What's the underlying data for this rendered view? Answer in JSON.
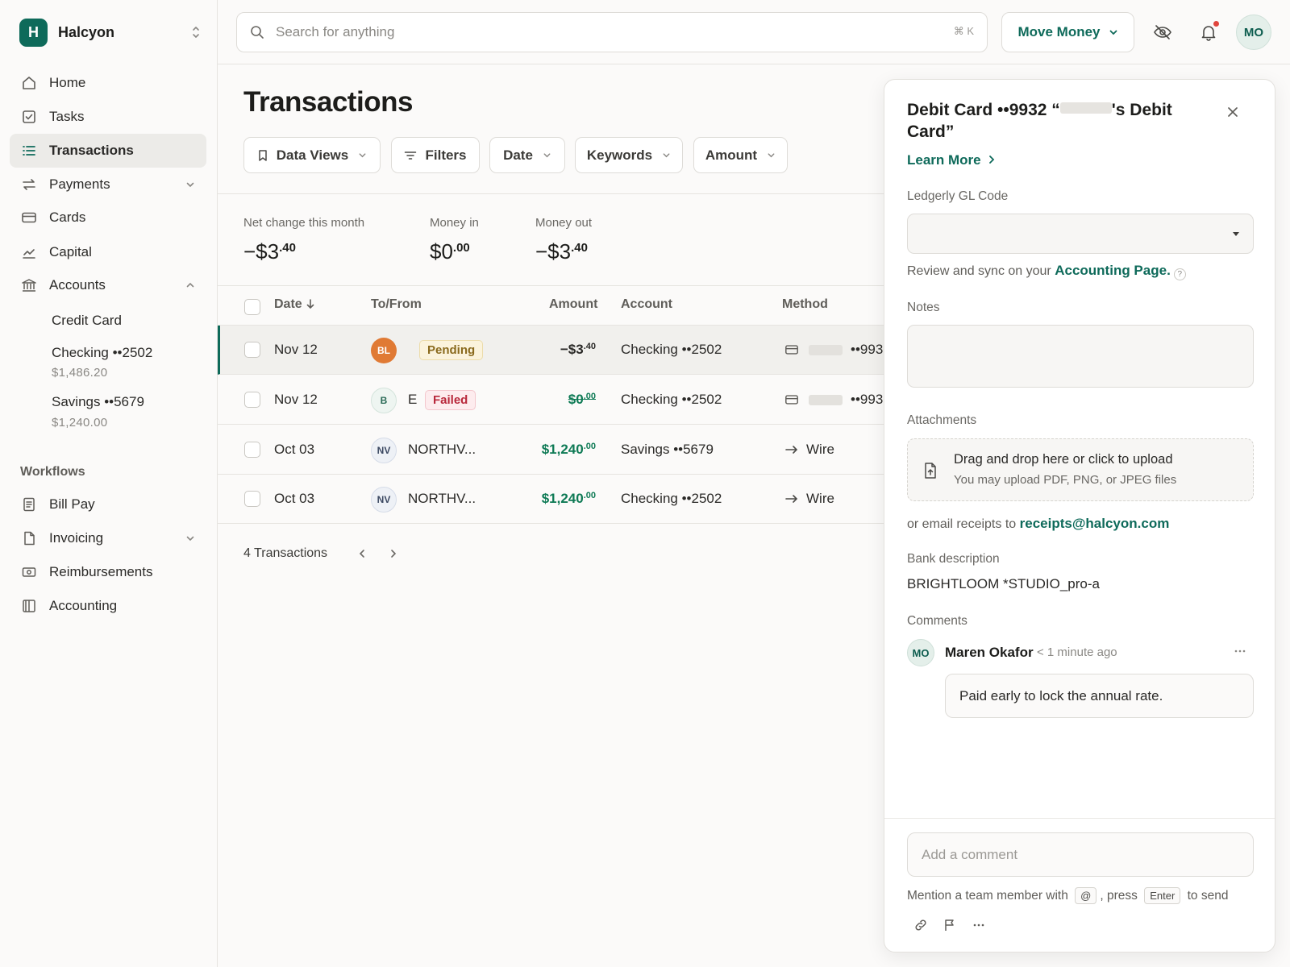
{
  "brand": {
    "initial": "H",
    "name": "Halcyon"
  },
  "nav": {
    "items": [
      {
        "label": "Home",
        "icon": "home-icon"
      },
      {
        "label": "Tasks",
        "icon": "checkbox-icon"
      },
      {
        "label": "Transactions",
        "icon": "list-icon",
        "active": true
      },
      {
        "label": "Payments",
        "icon": "arrows-icon"
      },
      {
        "label": "Cards",
        "icon": "card-icon"
      },
      {
        "label": "Capital",
        "icon": "chart-icon"
      },
      {
        "label": "Accounts",
        "icon": "bank-icon"
      }
    ],
    "accounts": [
      {
        "label": "Credit Card"
      },
      {
        "label": "Checking ••2502",
        "balance": "$1,486.20"
      },
      {
        "label": "Savings ••5679",
        "balance": "$1,240.00"
      }
    ],
    "workflows_label": "Workflows",
    "workflows": [
      {
        "label": "Bill Pay"
      },
      {
        "label": "Invoicing"
      },
      {
        "label": "Reimbursements"
      },
      {
        "label": "Accounting"
      }
    ]
  },
  "topbar": {
    "search_placeholder": "Search for anything",
    "search_shortcut": "⌘ K",
    "move_money": "Move Money",
    "user_initials": "MO"
  },
  "main": {
    "title": "Transactions",
    "filters": [
      "Data Views",
      "Filters",
      "Date",
      "Keywords",
      "Amount"
    ],
    "stats": [
      {
        "label": "Net change this month",
        "value": "−$3",
        "cents": ".40"
      },
      {
        "label": "Money in",
        "value": "$0",
        "cents": ".00"
      },
      {
        "label": "Money out",
        "value": "−$3",
        "cents": ".40"
      }
    ],
    "columns": [
      "Date",
      "To/From",
      "Amount",
      "Account",
      "Method"
    ],
    "rows": [
      {
        "date": "Nov 12",
        "avatar": "BL",
        "counterparty": "",
        "status": "Pending",
        "amount": "−$3",
        "cents": ".40",
        "account": "Checking ••2502",
        "method": "••993"
      },
      {
        "date": "Nov 12",
        "avatar": "B",
        "counterparty": "E",
        "status": "Failed",
        "amount": "$0",
        "cents": ".00",
        "account": "Checking ••2502",
        "method": "••993"
      },
      {
        "date": "Oct 03",
        "avatar": "NV",
        "counterparty": "NORTHV...",
        "status": "",
        "amount": "$1,240",
        "cents": ".00",
        "account": "Savings ••5679",
        "method": "Wire"
      },
      {
        "date": "Oct 03",
        "avatar": "NV",
        "counterparty": "NORTHV...",
        "status": "",
        "amount": "$1,240",
        "cents": ".00",
        "account": "Checking ••2502",
        "method": "Wire"
      }
    ],
    "count_label": "4 Transactions"
  },
  "drawer": {
    "title_prefix": "Debit Card ••9932 “",
    "title_suffix": "'s Debit Card”",
    "learn_more": "Learn More",
    "gl_label": "Ledgerly GL Code",
    "sync_text": "Review and sync on your",
    "sync_link": "Accounting Page.",
    "help": "?",
    "notes_label": "Notes",
    "attachments_label": "Attachments",
    "upload_title": "Drag and drop here or click to upload",
    "upload_sub": "You may upload PDF, PNG, or JPEG files",
    "email_text": "or email receipts to",
    "email_link": "receipts@halcyon.com",
    "bank_desc_label": "Bank description",
    "bank_desc": "BRIGHTLOOM *STUDIO_pro-a",
    "comments_label": "Comments",
    "comment": {
      "initials": "MO",
      "author": "Maren Okafor",
      "time": "< 1 minute ago",
      "text": "Paid early to lock the annual rate."
    },
    "comment_placeholder": "Add a comment",
    "mention_text_1": "Mention a team member with",
    "mention_key": "@",
    "mention_text_2": ", press",
    "enter_key": "Enter",
    "mention_text_3": "to send"
  },
  "colors": {
    "brand": "#0e6a5a",
    "positive": "#0e7a55",
    "pending_bg": "#fbf3dc",
    "pending_text": "#8a6a1d",
    "failed_bg": "#fdecee",
    "failed_text": "#b8283b"
  }
}
